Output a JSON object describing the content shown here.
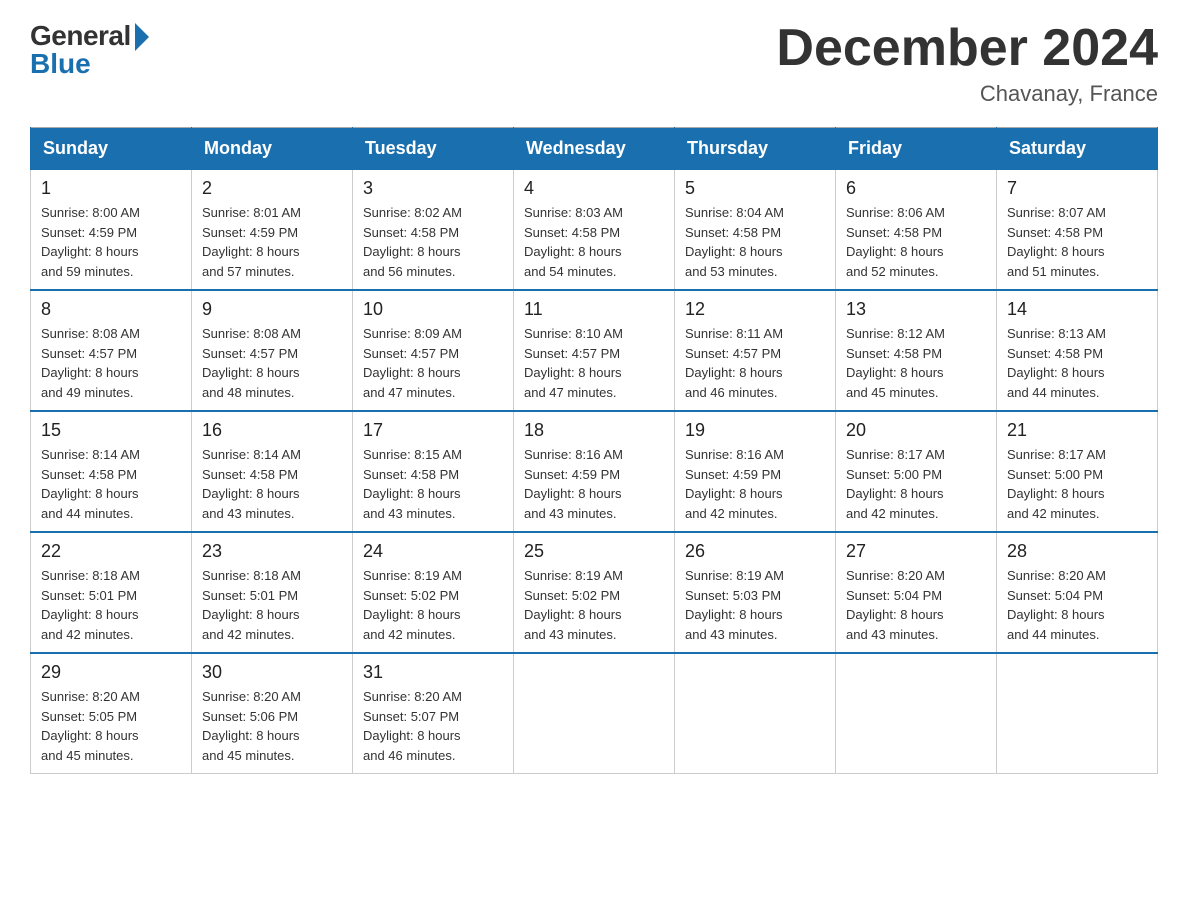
{
  "header": {
    "logo_general": "General",
    "logo_blue": "Blue",
    "title": "December 2024",
    "location": "Chavanay, France"
  },
  "calendar": {
    "days_of_week": [
      "Sunday",
      "Monday",
      "Tuesday",
      "Wednesday",
      "Thursday",
      "Friday",
      "Saturday"
    ],
    "weeks": [
      [
        {
          "day": "1",
          "sunrise": "8:00 AM",
          "sunset": "4:59 PM",
          "daylight": "8 hours and 59 minutes."
        },
        {
          "day": "2",
          "sunrise": "8:01 AM",
          "sunset": "4:59 PM",
          "daylight": "8 hours and 57 minutes."
        },
        {
          "day": "3",
          "sunrise": "8:02 AM",
          "sunset": "4:58 PM",
          "daylight": "8 hours and 56 minutes."
        },
        {
          "day": "4",
          "sunrise": "8:03 AM",
          "sunset": "4:58 PM",
          "daylight": "8 hours and 54 minutes."
        },
        {
          "day": "5",
          "sunrise": "8:04 AM",
          "sunset": "4:58 PM",
          "daylight": "8 hours and 53 minutes."
        },
        {
          "day": "6",
          "sunrise": "8:06 AM",
          "sunset": "4:58 PM",
          "daylight": "8 hours and 52 minutes."
        },
        {
          "day": "7",
          "sunrise": "8:07 AM",
          "sunset": "4:58 PM",
          "daylight": "8 hours and 51 minutes."
        }
      ],
      [
        {
          "day": "8",
          "sunrise": "8:08 AM",
          "sunset": "4:57 PM",
          "daylight": "8 hours and 49 minutes."
        },
        {
          "day": "9",
          "sunrise": "8:08 AM",
          "sunset": "4:57 PM",
          "daylight": "8 hours and 48 minutes."
        },
        {
          "day": "10",
          "sunrise": "8:09 AM",
          "sunset": "4:57 PM",
          "daylight": "8 hours and 47 minutes."
        },
        {
          "day": "11",
          "sunrise": "8:10 AM",
          "sunset": "4:57 PM",
          "daylight": "8 hours and 47 minutes."
        },
        {
          "day": "12",
          "sunrise": "8:11 AM",
          "sunset": "4:57 PM",
          "daylight": "8 hours and 46 minutes."
        },
        {
          "day": "13",
          "sunrise": "8:12 AM",
          "sunset": "4:58 PM",
          "daylight": "8 hours and 45 minutes."
        },
        {
          "day": "14",
          "sunrise": "8:13 AM",
          "sunset": "4:58 PM",
          "daylight": "8 hours and 44 minutes."
        }
      ],
      [
        {
          "day": "15",
          "sunrise": "8:14 AM",
          "sunset": "4:58 PM",
          "daylight": "8 hours and 44 minutes."
        },
        {
          "day": "16",
          "sunrise": "8:14 AM",
          "sunset": "4:58 PM",
          "daylight": "8 hours and 43 minutes."
        },
        {
          "day": "17",
          "sunrise": "8:15 AM",
          "sunset": "4:58 PM",
          "daylight": "8 hours and 43 minutes."
        },
        {
          "day": "18",
          "sunrise": "8:16 AM",
          "sunset": "4:59 PM",
          "daylight": "8 hours and 43 minutes."
        },
        {
          "day": "19",
          "sunrise": "8:16 AM",
          "sunset": "4:59 PM",
          "daylight": "8 hours and 42 minutes."
        },
        {
          "day": "20",
          "sunrise": "8:17 AM",
          "sunset": "5:00 PM",
          "daylight": "8 hours and 42 minutes."
        },
        {
          "day": "21",
          "sunrise": "8:17 AM",
          "sunset": "5:00 PM",
          "daylight": "8 hours and 42 minutes."
        }
      ],
      [
        {
          "day": "22",
          "sunrise": "8:18 AM",
          "sunset": "5:01 PM",
          "daylight": "8 hours and 42 minutes."
        },
        {
          "day": "23",
          "sunrise": "8:18 AM",
          "sunset": "5:01 PM",
          "daylight": "8 hours and 42 minutes."
        },
        {
          "day": "24",
          "sunrise": "8:19 AM",
          "sunset": "5:02 PM",
          "daylight": "8 hours and 42 minutes."
        },
        {
          "day": "25",
          "sunrise": "8:19 AM",
          "sunset": "5:02 PM",
          "daylight": "8 hours and 43 minutes."
        },
        {
          "day": "26",
          "sunrise": "8:19 AM",
          "sunset": "5:03 PM",
          "daylight": "8 hours and 43 minutes."
        },
        {
          "day": "27",
          "sunrise": "8:20 AM",
          "sunset": "5:04 PM",
          "daylight": "8 hours and 43 minutes."
        },
        {
          "day": "28",
          "sunrise": "8:20 AM",
          "sunset": "5:04 PM",
          "daylight": "8 hours and 44 minutes."
        }
      ],
      [
        {
          "day": "29",
          "sunrise": "8:20 AM",
          "sunset": "5:05 PM",
          "daylight": "8 hours and 45 minutes."
        },
        {
          "day": "30",
          "sunrise": "8:20 AM",
          "sunset": "5:06 PM",
          "daylight": "8 hours and 45 minutes."
        },
        {
          "day": "31",
          "sunrise": "8:20 AM",
          "sunset": "5:07 PM",
          "daylight": "8 hours and 46 minutes."
        },
        null,
        null,
        null,
        null
      ]
    ]
  }
}
